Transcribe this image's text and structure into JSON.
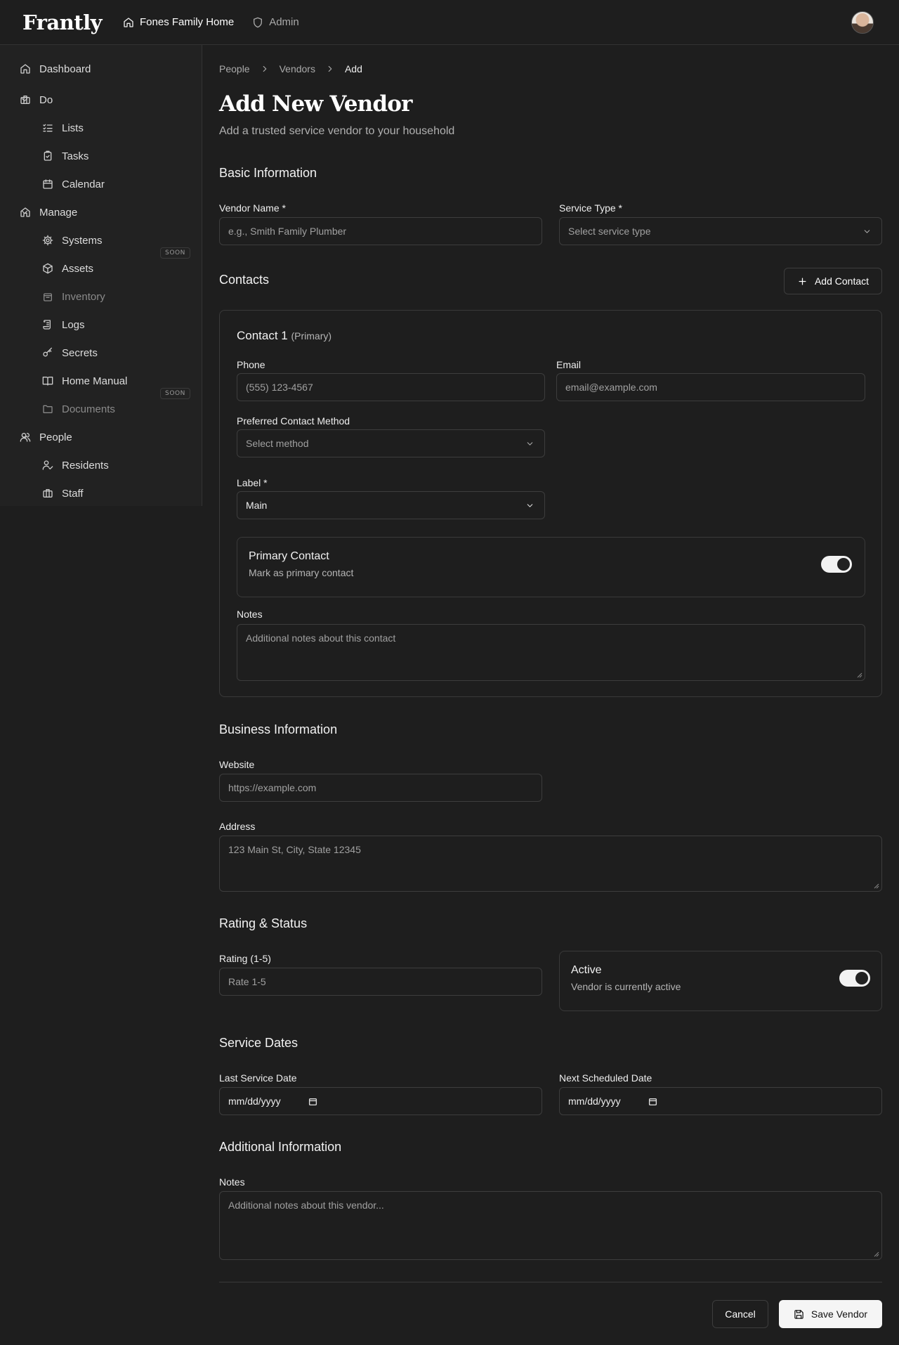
{
  "app": {
    "logo": "Frantly"
  },
  "topnav": {
    "home": "Fones Family Home",
    "admin": "Admin"
  },
  "sidebar": {
    "dashboard": "Dashboard",
    "do": {
      "label": "Do",
      "items": [
        "Lists",
        "Tasks",
        "Calendar"
      ]
    },
    "manage": {
      "label": "Manage",
      "items": [
        "Systems",
        "Assets",
        "Inventory",
        "Logs",
        "Secrets",
        "Home Manual",
        "Documents"
      ]
    },
    "people": {
      "label": "People",
      "items": [
        "Residents",
        "Staff"
      ]
    },
    "soon_badge": "SOON"
  },
  "breadcrumb": [
    "People",
    "Vendors",
    "Add"
  ],
  "page": {
    "title": "Add New Vendor",
    "subtitle": "Add a trusted service vendor to your household"
  },
  "basic": {
    "title": "Basic Information",
    "vendor_name_label": "Vendor Name *",
    "vendor_name_placeholder": "e.g., Smith Family Plumber",
    "service_type_label": "Service Type *",
    "service_type_placeholder": "Select service type"
  },
  "contacts": {
    "title": "Contacts",
    "add_button": "Add Contact",
    "contact1": {
      "title": "Contact 1",
      "tag": "(Primary)",
      "phone_label": "Phone",
      "phone_placeholder": "(555) 123-4567",
      "email_label": "Email",
      "email_placeholder": "email@example.com",
      "method_label": "Preferred Contact Method",
      "method_placeholder": "Select method",
      "label_label": "Label *",
      "label_value": "Main",
      "primary_title": "Primary Contact",
      "primary_desc": "Mark as primary contact",
      "primary_on": true,
      "notes_label": "Notes",
      "notes_placeholder": "Additional notes about this contact"
    }
  },
  "business": {
    "title": "Business Information",
    "website_label": "Website",
    "website_placeholder": "https://example.com",
    "address_label": "Address",
    "address_placeholder": "123 Main St, City, State 12345"
  },
  "rating": {
    "title": "Rating & Status",
    "rating_label": "Rating (1-5)",
    "rating_placeholder": "Rate 1-5",
    "active_title": "Active",
    "active_desc": "Vendor is currently active",
    "active_on": true
  },
  "dates": {
    "title": "Service Dates",
    "last_label": "Last Service Date",
    "next_label": "Next Scheduled Date",
    "date_placeholder": "mm/dd/yyyy"
  },
  "additional": {
    "title": "Additional Information",
    "notes_label": "Notes",
    "notes_placeholder": "Additional notes about this vendor..."
  },
  "actions": {
    "cancel": "Cancel",
    "save": "Save Vendor"
  }
}
